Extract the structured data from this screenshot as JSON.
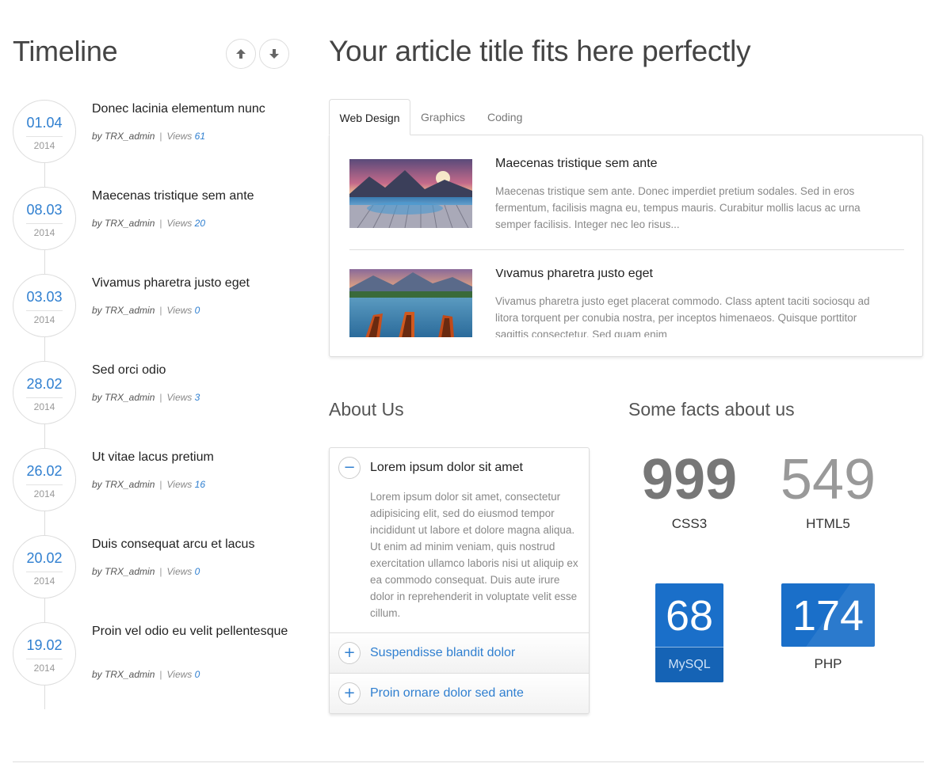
{
  "timeline": {
    "title": "Timeline",
    "items": [
      {
        "day": "01.04",
        "year": "2014",
        "title": "Donec lacinia elementum nunc",
        "by": "by TRX_admin",
        "views_label": "Views",
        "views": "61"
      },
      {
        "day": "08.03",
        "year": "2014",
        "title": "Maecenas tristique sem ante",
        "by": "by TRX_admin",
        "views_label": "Views",
        "views": "20"
      },
      {
        "day": "03.03",
        "year": "2014",
        "title": "Vivamus pharetra justo eget",
        "by": "by TRX_admin",
        "views_label": "Views",
        "views": "0"
      },
      {
        "day": "28.02",
        "year": "2014",
        "title": "Sed orci odio",
        "by": "by TRX_admin",
        "views_label": "Views",
        "views": "3"
      },
      {
        "day": "26.02",
        "year": "2014",
        "title": "Ut vitae lacus pretium",
        "by": "by TRX_admin",
        "views_label": "Views",
        "views": "16"
      },
      {
        "day": "20.02",
        "year": "2014",
        "title": "Duis consequat arcu et lacus",
        "by": "by TRX_admin",
        "views_label": "Views",
        "views": "0"
      },
      {
        "day": "19.02",
        "year": "2014",
        "title": "Proin vel odio eu velit pellentesque",
        "by": "by TRX_admin",
        "views_label": "Views",
        "views": "0"
      }
    ]
  },
  "article": {
    "title": "Your article title fits here perfectly",
    "tabs": [
      "Web Design",
      "Graphics",
      "Coding"
    ],
    "posts": [
      {
        "title": "Maecenas tristique sem ante",
        "excerpt": "Maecenas tristique sem ante. Donec imperdiet pretium sodales. Sed in eros fermentum, facilisis magna eu, tempus mauris. Curabitur mollis lacus ac urna semper facilisis. Integer nec leo risus..."
      },
      {
        "title": "Vivamus pharetra justo eget",
        "excerpt": "Vivamus pharetra justo eget placerat commodo. Class aptent taciti sociosqu ad litora torquent per conubia nostra, per inceptos himenaeos. Quisque porttitor sagittis consectetur. Sed quam enim"
      }
    ]
  },
  "about": {
    "title": "About Us",
    "sections": [
      {
        "icon": "−",
        "heading": "Lorem ipsum dolor sit amet",
        "body": "Lorem ipsum dolor sit amet, consectetur adipisicing elit, sed do eiusmod tempor incididunt ut labore et dolore magna aliqua. Ut enim ad minim veniam, quis nostrud exercitation ullamco laboris nisi ut aliquip ex ea commodo consequat. Duis aute irure dolor in reprehenderit in voluptate velit esse cillum."
      },
      {
        "icon": "+",
        "heading": "Suspendisse blandit dolor"
      },
      {
        "icon": "+",
        "heading": "Proin ornare dolor sed ante"
      }
    ]
  },
  "facts": {
    "title": "Some facts about us",
    "items": [
      {
        "value": "999",
        "label": "CSS3"
      },
      {
        "value": "549",
        "label": "HTML5"
      },
      {
        "value": "68",
        "label": "MySQL"
      },
      {
        "value": "174",
        "label": "PHP"
      }
    ]
  },
  "colors": {
    "accent": "#2f7fd0",
    "box_blue": "#1a6fc9"
  }
}
